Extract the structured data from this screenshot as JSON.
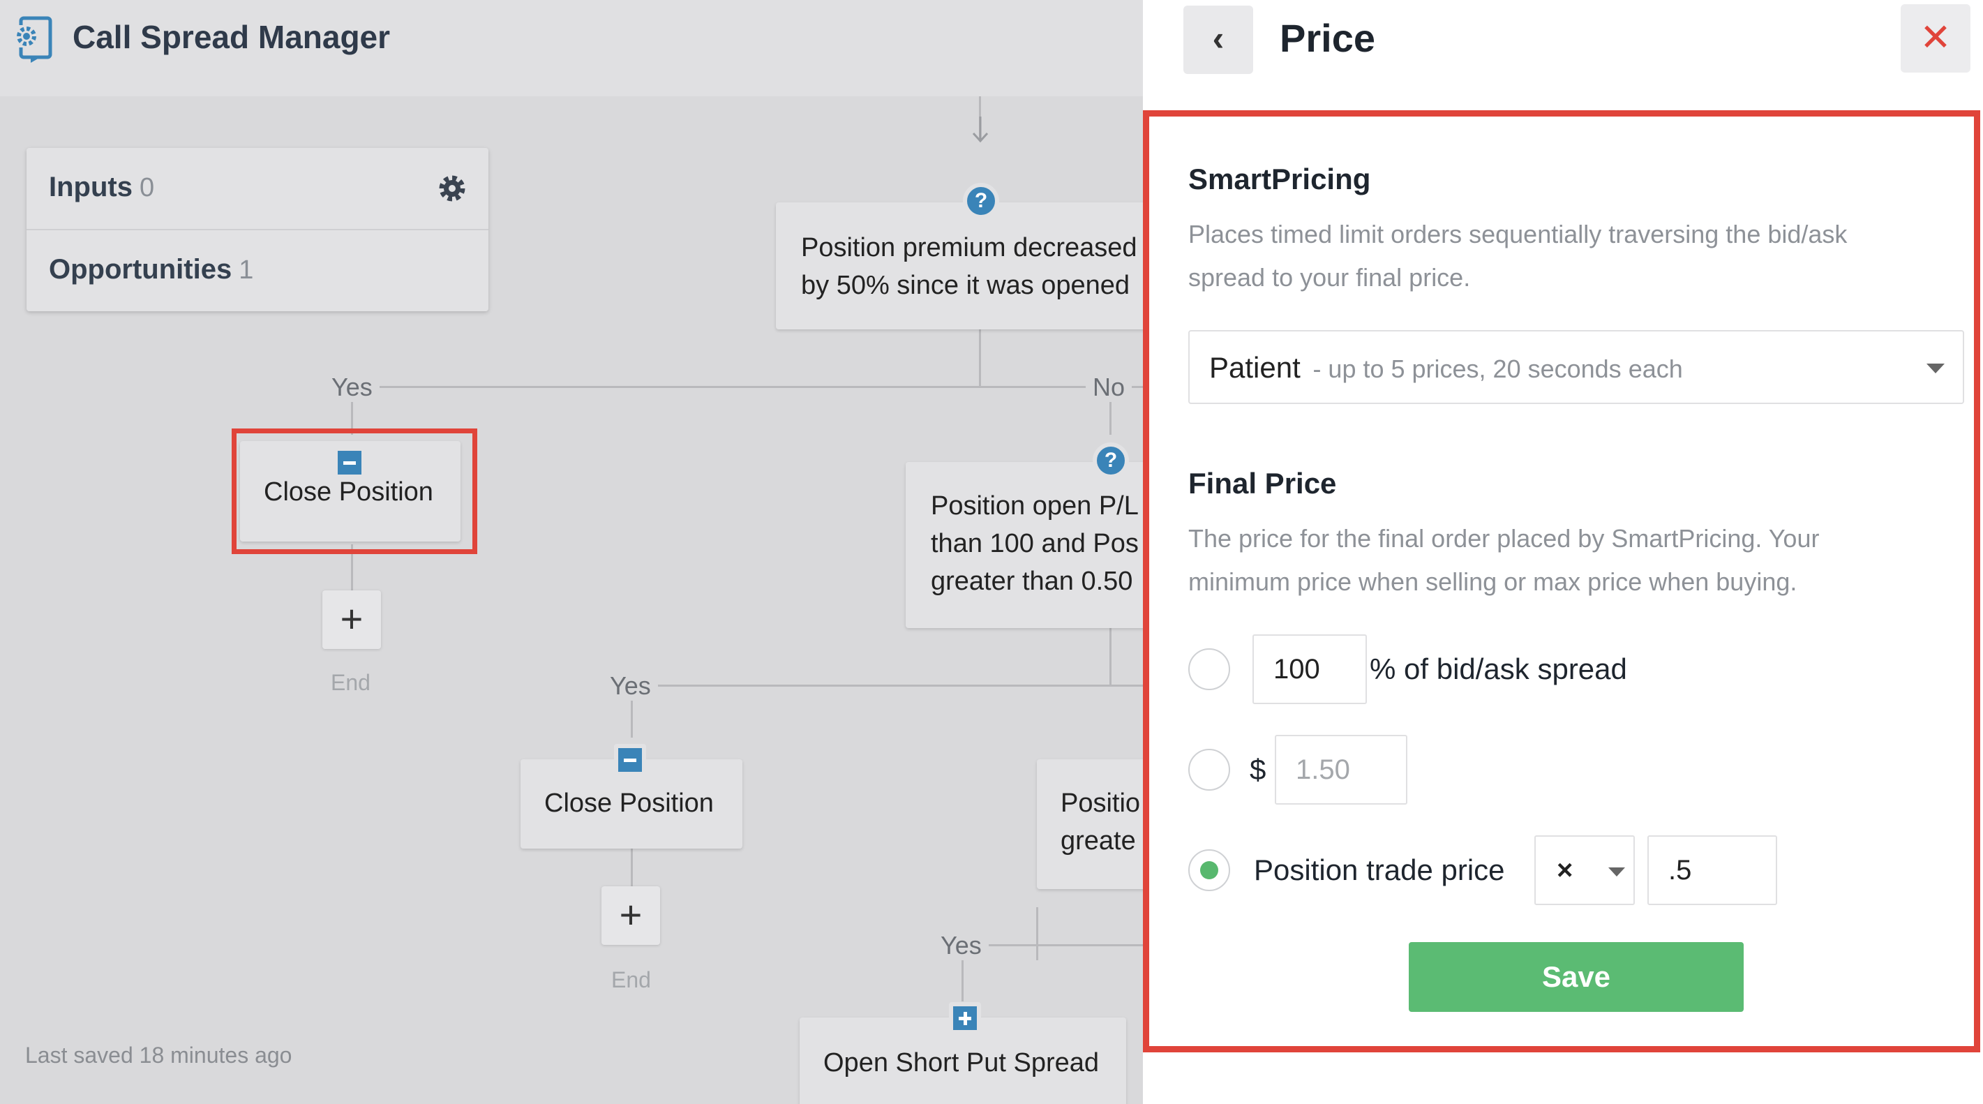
{
  "app": {
    "title": "Call Spread Manager"
  },
  "sidebar": {
    "inputs_label": "Inputs",
    "inputs_count": "0",
    "opportunities_label": "Opportunities",
    "opportunities_count": "1"
  },
  "flow": {
    "node1_line1": "Position premium decreased",
    "node1_line2": "by 50% since it was opened",
    "yes": "Yes",
    "no": "No",
    "close_position": "Close Position",
    "end": "End",
    "node2_line1": "Position open P/L",
    "node2_line2": "than 100 and Pos",
    "node2_line3": "greater than 0.50",
    "node3_line1": "Positio",
    "node3_line2": "greate",
    "open_short_put": "Open Short Put Spread",
    "add_symbol": "+",
    "question_symbol": "?"
  },
  "footer": {
    "saved": "Last saved 18 minutes ago"
  },
  "panel": {
    "title": "Price",
    "back_symbol": "‹",
    "close_symbol": "✕",
    "smart": {
      "title": "SmartPricing",
      "desc": "Places timed limit orders sequentially traversing the bid/ask spread to your final price.",
      "select_value": "Patient",
      "select_sub": "- up to 5 prices, 20 seconds each"
    },
    "final": {
      "title": "Final Price",
      "desc": "The price for the final order placed by SmartPricing. Your minimum price when selling or max price when buying.",
      "pct_value": "100",
      "pct_label": "% of bid/ask spread",
      "dollar_sign": "$",
      "dollar_placeholder": "1.50",
      "trade_label": "Position trade price",
      "operator": "×",
      "multiplier": ".5",
      "selected_option": "Position trade price"
    },
    "save_label": "Save"
  },
  "colors": {
    "accent_red": "#e0443a",
    "save_green": "#5bbb73",
    "icon_blue": "#3a84b8"
  }
}
